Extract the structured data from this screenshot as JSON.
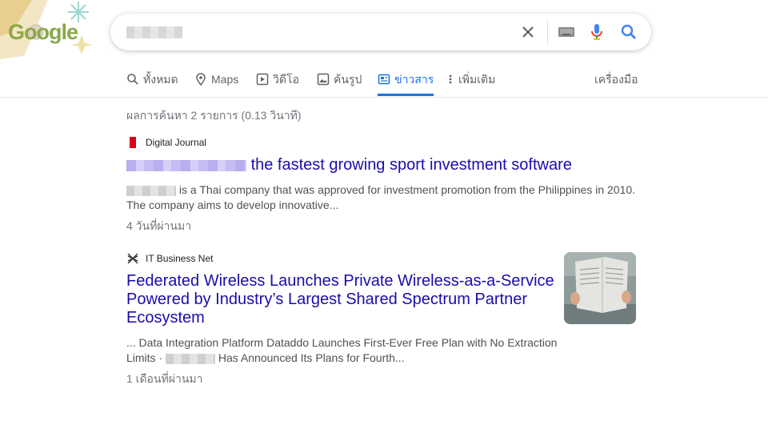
{
  "logo": {
    "text": "Google"
  },
  "search": {
    "query_text": ""
  },
  "tabs": [
    {
      "label": "ทั้งหมด",
      "icon": "search-icon"
    },
    {
      "label": "Maps",
      "icon": "map-pin-icon"
    },
    {
      "label": "วิดีโอ",
      "icon": "video-icon"
    },
    {
      "label": "ค้นรูป",
      "icon": "image-icon"
    },
    {
      "label": "ข่าวสาร",
      "icon": "news-icon",
      "active": true
    },
    {
      "label": "เพิ่มเติม",
      "icon": "more-vertical-icon"
    }
  ],
  "tools_label": "เครื่องมือ",
  "result_stats": "ผลการค้นหา 2 รายการ (0.13 วินาที)",
  "results": [
    {
      "source": "Digital Journal",
      "title": "the fastest growing sport investment software",
      "snippet_line1": "is a Thai company that was approved for investment promotion from the Philippines in 2010.",
      "snippet_line2": "The company aims to develop innovative...",
      "date": "4 วันที่ผ่านมา"
    },
    {
      "source": "IT Business Net",
      "title": "Federated Wireless Launches Private Wireless-as-a-Service Powered by Industry’s Largest Shared Spectrum Partner Ecosystem",
      "snippet_line1": "... Data Integration Platform Dataddo Launches First-Ever Free Plan with No Extraction",
      "snippet_line2_prefix": "Limits ·",
      "snippet_line2_suffix": "Has Announced Its Plans for Fourth...",
      "date": "1 เดือนที่ผ่านมา"
    }
  ],
  "colors": {
    "link": "#1a0dab",
    "active_tab": "#1a73e8",
    "digital_journal_red": "#d6001c"
  }
}
